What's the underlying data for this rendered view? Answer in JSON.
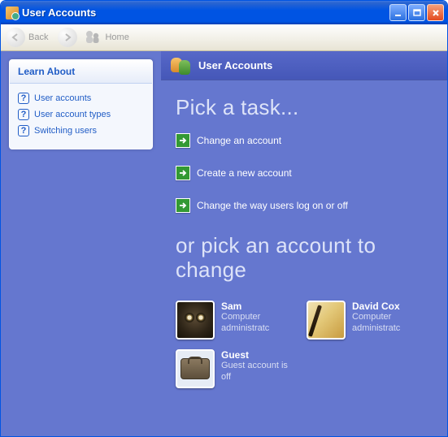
{
  "window": {
    "title": "User Accounts"
  },
  "toolbar": {
    "back_label": "Back",
    "home_label": "Home"
  },
  "sidebar": {
    "header": "Learn About",
    "items": [
      {
        "label": "User accounts"
      },
      {
        "label": "User account types"
      },
      {
        "label": "Switching users"
      }
    ]
  },
  "main": {
    "header_title": "User Accounts",
    "pick_task_headline": "Pick a task...",
    "tasks": [
      {
        "label": "Change an account"
      },
      {
        "label": "Create a new account"
      },
      {
        "label": "Change the way users log on or off"
      }
    ],
    "pick_account_headline": "or pick an account to change",
    "accounts": [
      {
        "name": "Sam",
        "role": "Computer administratc",
        "avatar": "owl"
      },
      {
        "name": "David Cox",
        "role": "Computer administratc",
        "avatar": "guitar"
      },
      {
        "name": "Guest",
        "role": "Guest account is off",
        "avatar": "suitcase"
      }
    ]
  }
}
